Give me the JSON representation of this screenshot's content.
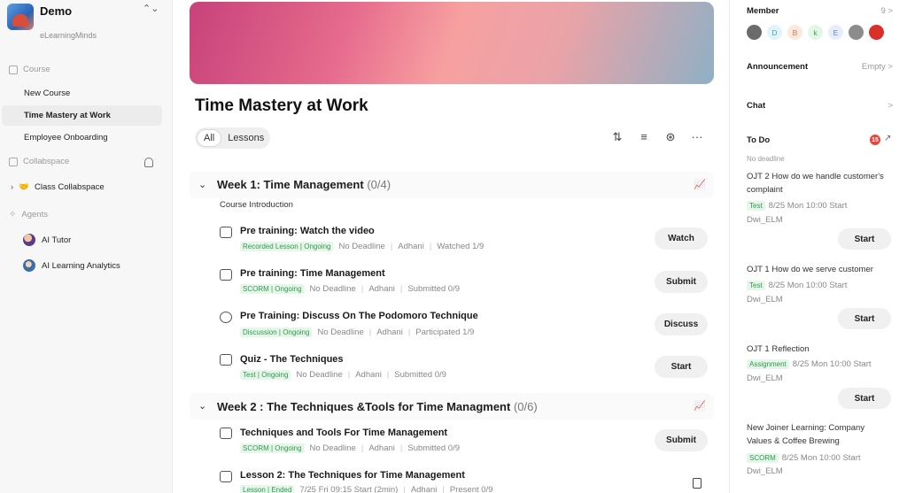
{
  "workspace": {
    "title": "Demo",
    "subtitle": "eLearningMinds",
    "switch_glyph": "⌃⌄"
  },
  "sidebar": {
    "course_section": "Course",
    "course_items": [
      "New Course",
      "Time Mastery at Work",
      "Employee Onboarding"
    ],
    "collab_section": "Collabspace",
    "collab_item": "Class Collabspace",
    "collab_emoji": "🤝",
    "agents_section": "Agents",
    "agents": [
      "AI Tutor",
      "AI Learning Analytics"
    ]
  },
  "main": {
    "title": "Time Mastery at Work",
    "filters": [
      "All",
      "Lessons"
    ],
    "tools": [
      "⇅",
      "≡",
      "⊛",
      "···"
    ],
    "weeks": [
      {
        "title": "Week 1: Time Management",
        "count": "(0/4)",
        "intro": "Course Introduction"
      },
      {
        "title": "Week 2 : The Techniques &Tools for Time Managment",
        "count": "(0/6)"
      }
    ],
    "lessons": [
      {
        "title": "Pre training: Watch the video",
        "tag": "Recorded Lesson | Ongoing",
        "deadline": "No Deadline",
        "author": "Adhani",
        "status": "Watched  1/9",
        "action": "Watch"
      },
      {
        "title": "Pre training: Time Management",
        "tag": "SCORM | Ongoing",
        "deadline": "No Deadline",
        "author": "Adhani",
        "status": "Submitted  0/9",
        "action": "Submit"
      },
      {
        "title": "Pre Training: Discuss On The Podomoro Technique",
        "tag": "Discussion | Ongoing",
        "deadline": "No Deadline",
        "author": "Adhani",
        "status": "Participated  1/9",
        "action": "Discuss"
      },
      {
        "title": "Quiz - The Techniques",
        "tag": "Test | Ongoing",
        "deadline": "No Deadline",
        "author": "Adhani",
        "status": "Submitted  0/9",
        "action": "Start"
      },
      {
        "title": "Techniques and Tools For Time Management",
        "tag": "SCORM | Ongoing",
        "deadline": "No Deadline",
        "author": "Adhani",
        "status": "Submitted  0/9",
        "action": "Submit"
      },
      {
        "title": "Lesson 2: The Techniques for Time Management",
        "tag": "Lesson | Ended",
        "deadline": "7/25 Fri 09:15 Start (2min)",
        "author": "Adhani",
        "status": "Present  0/9"
      }
    ]
  },
  "right_panel": {
    "member_label": "Member",
    "member_count": "9 >",
    "avatars": [
      {
        "letter": "",
        "bg": "#6b6b6b",
        "fg": "#ffffff"
      },
      {
        "letter": "D",
        "bg": "#e3f3fb",
        "fg": "#4aa3c9"
      },
      {
        "letter": "B",
        "bg": "#fbe9df",
        "fg": "#d07a4e"
      },
      {
        "letter": "k",
        "bg": "#e4f6e6",
        "fg": "#3aa35a"
      },
      {
        "letter": "E",
        "bg": "#e6eefb",
        "fg": "#5e86cc"
      },
      {
        "letter": "",
        "bg": "#8c8c8c",
        "fg": "#ffffff"
      },
      {
        "letter": "",
        "bg": "#d9302a",
        "fg": "#ffffff"
      }
    ],
    "announcement_label": "Announcement",
    "announcement_value": "Empty >",
    "chat_label": "Chat",
    "chat_arrow": ">",
    "todo_label": "To Do",
    "todo_count": "15",
    "todo_arrow": "↗",
    "no_deadline": "No deadline",
    "todos": [
      {
        "title": "OJT 2 How do we handle customer's complaint",
        "tag": "Test",
        "when": "8/25 Mon 10:00 Start",
        "user": "Dwi_ELM",
        "action": "Start"
      },
      {
        "title": "OJT 1 How do we serve customer",
        "tag": "Test",
        "when": "8/25 Mon 10:00 Start",
        "user": "Dwi_ELM",
        "action": "Start"
      },
      {
        "title": "OJT 1 Reflection",
        "tag": "Assignment",
        "when": "8/25 Mon 10:00 Start",
        "user": "Dwi_ELM",
        "action": "Start"
      },
      {
        "title": "New Joiner Learning: Company Values & Coffee Brewing",
        "tag": "SCORM",
        "when": "8/25 Mon 10:00 Start",
        "user": "Dwi_ELM"
      }
    ]
  }
}
